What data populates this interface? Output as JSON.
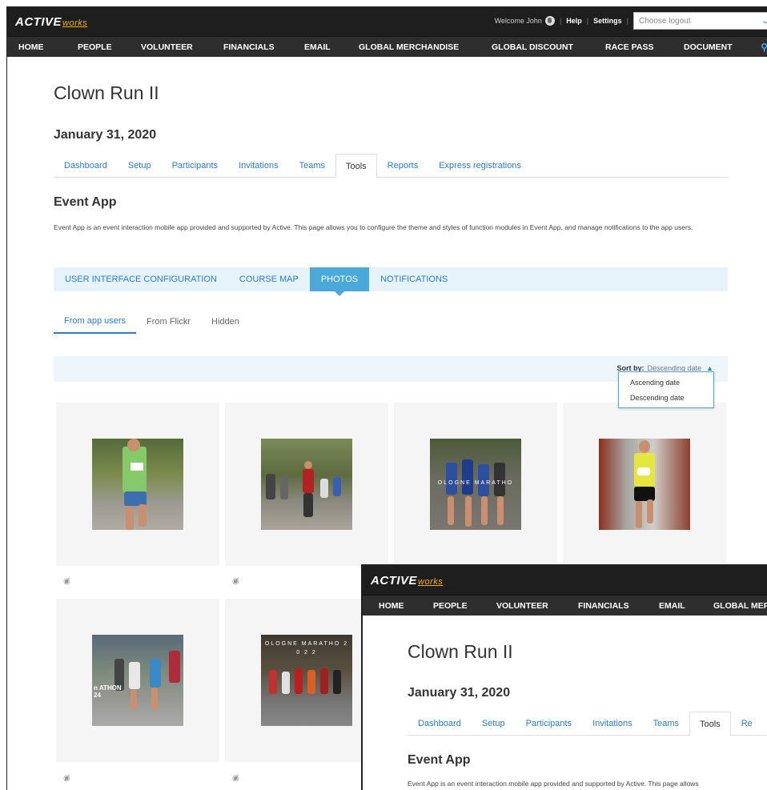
{
  "brand": {
    "name": "ACTIVE",
    "suffix": "works"
  },
  "topbar": {
    "welcome": "Welcome John",
    "help": "Help",
    "settings": "Settings",
    "logout_placeholder": "Choose logout"
  },
  "nav": {
    "items": [
      "HOME",
      "PEOPLE",
      "VOLUNTEER",
      "FINANCIALS",
      "EMAIL",
      "GLOBAL MERCHANDISE",
      "GLOBAL DISCOUNT",
      "RACE PASS",
      "DOCUMENT"
    ],
    "overlay_items": [
      "HOME",
      "PEOPLE",
      "VOLUNTEER",
      "FINANCIALS",
      "EMAIL",
      "GLOBAL MER"
    ]
  },
  "event": {
    "title": "Clown Run II",
    "date": "January 31, 2020"
  },
  "tabs": [
    "Dashboard",
    "Setup",
    "Participants",
    "Invitations",
    "Teams",
    "Tools",
    "Reports",
    "Express registrations"
  ],
  "overlay_tabs": [
    "Dashboard",
    "Setup",
    "Participants",
    "Invitations",
    "Teams",
    "Tools",
    "Re"
  ],
  "active_tab": "Tools",
  "event_app": {
    "title": "Event App",
    "description": "Event App is an event interaction mobile app provided and supported by Active. This page allows you to configure the theme and styles of function modules in Event App, and manage notifications to the app users.",
    "description_truncated": "Event App is an event interaction mobile app provided and supported by Active. This page allows"
  },
  "config_tabs": [
    "USER INTERFACE CONFIGURATION",
    "COURSE MAP",
    "PHOTOS",
    "NOTIFICATIONS"
  ],
  "active_config_tab": "PHOTOS",
  "photo_tabs": [
    "From app users",
    "From Flickr",
    "Hidden"
  ],
  "active_photo_tab": "From app users",
  "sort": {
    "label": "Sort by:",
    "value": "Descending date",
    "options": [
      "Ascending date",
      "Descending date"
    ]
  },
  "photos": [
    {
      "overlay_text": ""
    },
    {
      "overlay_text": ""
    },
    {
      "overlay_text": "OLOGNE MARATHO"
    },
    {
      "overlay_text": ""
    },
    {
      "overlay_text": "n ATHON 24"
    },
    {
      "overlay_text": "OLOGNE MARATHO 2 0 2 2"
    }
  ],
  "icons": {
    "hide": "eye-hide-icon",
    "search": "search-icon",
    "globe": "globe-icon",
    "chevron": "chevron-down-icon"
  },
  "colors": {
    "accent": "#2a7dc9",
    "active_tab_bg": "#4aa8da",
    "topbar": "#1e1e1e",
    "navbar": "#2e2e2e",
    "brand_accent": "#f0b400"
  }
}
